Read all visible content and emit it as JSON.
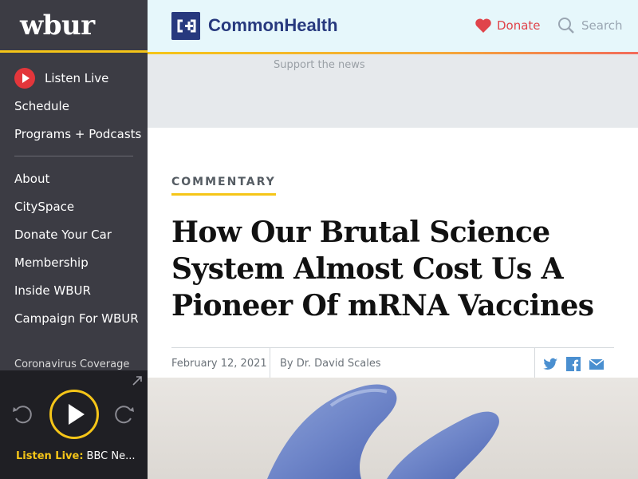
{
  "sidebar": {
    "logo": "wbur",
    "listen_live": "Listen Live",
    "items_primary": [
      "Schedule",
      "Programs + Podcasts"
    ],
    "items_secondary": [
      "About",
      "CitySpace",
      "Donate Your Car",
      "Membership",
      "Inside WBUR",
      "Campaign For WBUR"
    ],
    "coverage": "Coronavirus Coverage"
  },
  "player": {
    "live_label": "Listen Live:",
    "station": "BBC Ne..."
  },
  "header": {
    "brand": "CommonHealth",
    "donate": "Donate",
    "search": "Search"
  },
  "ad": {
    "label": "Support the news"
  },
  "article": {
    "category": "COMMENTARY",
    "headline": "How Our Brutal Science System Almost Cost Us A Pioneer Of mRNA Vaccines",
    "date": "February 12, 2021",
    "byline": "By Dr. David Scales"
  },
  "icons": {
    "donate": "heart-icon",
    "search": "search-icon",
    "twitter": "twitter-icon",
    "facebook": "facebook-icon",
    "email": "email-icon"
  },
  "colors": {
    "sidebar": "#3c3c44",
    "accent_yellow": "#f5c518",
    "brand_navy": "#27397e",
    "donate_red": "#e0444b",
    "share_blue": "#4a8fd0"
  }
}
